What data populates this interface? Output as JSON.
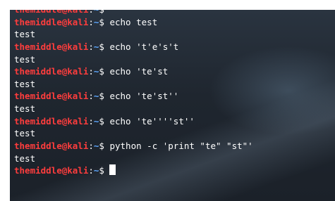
{
  "terminal": {
    "prompt": {
      "user_host": "themiddle@kali",
      "separator": ":",
      "path": "~",
      "symbol": "$ "
    },
    "lines": [
      {
        "type": "prompt",
        "command": ""
      },
      {
        "type": "prompt",
        "command": "echo test"
      },
      {
        "type": "output",
        "text": "test"
      },
      {
        "type": "prompt",
        "command": "echo 't'e's't"
      },
      {
        "type": "output",
        "text": "test"
      },
      {
        "type": "prompt",
        "command": "echo 'te'st"
      },
      {
        "type": "output",
        "text": "test"
      },
      {
        "type": "prompt",
        "command": "echo 'te'st''"
      },
      {
        "type": "output",
        "text": "test"
      },
      {
        "type": "prompt",
        "command": "echo 'te''''st''"
      },
      {
        "type": "output",
        "text": "test"
      },
      {
        "type": "prompt",
        "command": "python -c 'print \"te\" \"st\"'"
      },
      {
        "type": "output",
        "text": "test"
      },
      {
        "type": "prompt",
        "command": "",
        "cursor": true
      }
    ],
    "colors": {
      "user_host": "#ff3d3d",
      "path": "#5ea8ff",
      "text": "#ffffff",
      "background": "#1f262f"
    }
  }
}
